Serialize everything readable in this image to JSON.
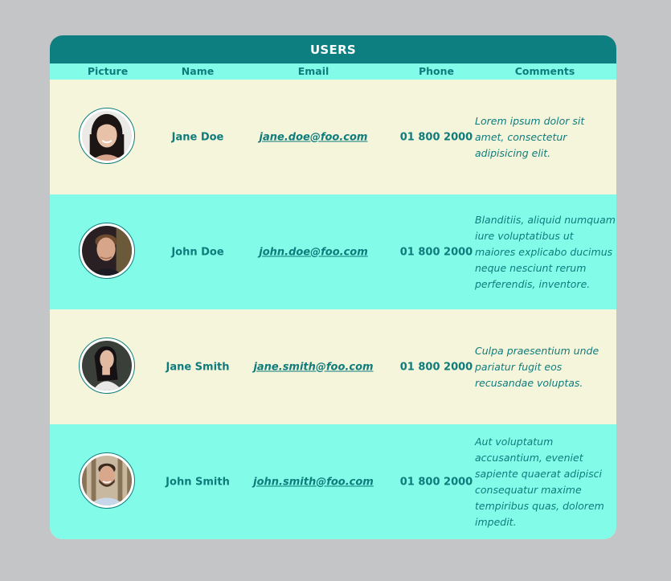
{
  "table": {
    "title": "USERS",
    "headers": {
      "picture": "Picture",
      "name": "Name",
      "email": "Email",
      "phone": "Phone",
      "comments": "Comments"
    },
    "rows": [
      {
        "name": "Jane Doe",
        "email": "jane.doe@foo.com",
        "phone": "01 800 2000",
        "comment": "Lorem ipsum dolor sit amet, consectetur adipisicing elit."
      },
      {
        "name": "John Doe",
        "email": "john.doe@foo.com",
        "phone": "01 800 2000",
        "comment": "Blanditiis, aliquid numquam iure voluptatibus ut maiores explicabo ducimus neque nesciunt rerum perferendis, inventore."
      },
      {
        "name": "Jane Smith",
        "email": "jane.smith@foo.com",
        "phone": "01 800 2000",
        "comment": "Culpa praesentium unde pariatur fugit eos recusandae voluptas."
      },
      {
        "name": "John Smith",
        "email": "john.smith@foo.com",
        "phone": "01 800 2000",
        "comment": "Aut voluptatum accusantium, eveniet sapiente quaerat adipisci consequatur maxime tempiribus quas, dolorem impedit."
      }
    ]
  },
  "colors": {
    "page_background": "#c4c5c7",
    "title_bar": "#0d7f80",
    "header_row": "#83fbe9",
    "row_light": "#f5f5dc",
    "row_aqua": "#83fbe9",
    "text": "#0f7c7c"
  }
}
